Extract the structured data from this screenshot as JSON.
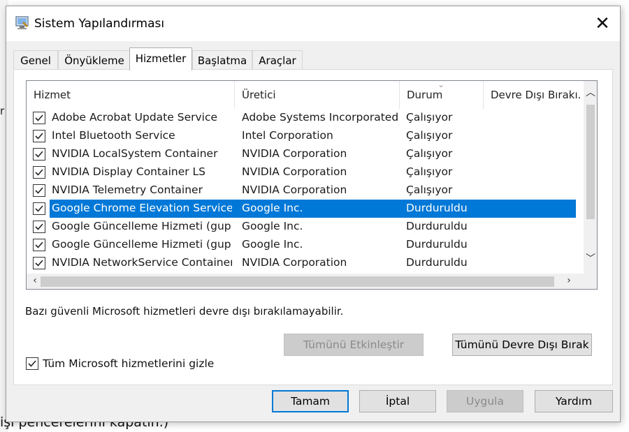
{
  "background": {
    "text": "işi pencerelerini kapatın.)"
  },
  "window": {
    "title": "Sistem Yapılandırması",
    "close_glyph": "✕"
  },
  "tabs": [
    {
      "label": "Genel",
      "active": false
    },
    {
      "label": "Önyükleme",
      "active": false
    },
    {
      "label": "Hizmetler",
      "active": true
    },
    {
      "label": "Başlatma",
      "active": false
    },
    {
      "label": "Araçlar",
      "active": false
    }
  ],
  "services": {
    "columns": [
      "Hizmet",
      "Üretici",
      "Durum",
      "Devre Dışı Bırakı."
    ],
    "rows": [
      {
        "name": "Adobe Acrobat Update Service",
        "vendor": "Adobe Systems Incorporated",
        "status": "Çalışıyor",
        "checked": true,
        "selected": false
      },
      {
        "name": "Intel Bluetooth Service",
        "vendor": "Intel Corporation",
        "status": "Çalışıyor",
        "checked": true,
        "selected": false
      },
      {
        "name": "NVIDIA LocalSystem Container",
        "vendor": "NVIDIA Corporation",
        "status": "Çalışıyor",
        "checked": true,
        "selected": false
      },
      {
        "name": "NVIDIA Display Container LS",
        "vendor": "NVIDIA Corporation",
        "status": "Çalışıyor",
        "checked": true,
        "selected": false
      },
      {
        "name": "NVIDIA Telemetry Container",
        "vendor": "NVIDIA Corporation",
        "status": "Çalışıyor",
        "checked": true,
        "selected": false
      },
      {
        "name": "Google Chrome Elevation Service",
        "vendor": "Google Inc.",
        "status": "Durduruldu",
        "checked": true,
        "selected": true
      },
      {
        "name": "Google Güncelleme Hizmeti (gup...",
        "vendor": "Google Inc.",
        "status": "Durduruldu",
        "checked": true,
        "selected": false
      },
      {
        "name": "Google Güncelleme Hizmeti (gup...",
        "vendor": "Google Inc.",
        "status": "Durduruldu",
        "checked": true,
        "selected": false
      },
      {
        "name": "NVIDIA NetworkService Container",
        "vendor": "NVIDIA Corporation",
        "status": "Durduruldu",
        "checked": true,
        "selected": false
      }
    ]
  },
  "note": "Bazı güvenli Microsoft hizmetleri devre dışı bırakılamayabilir.",
  "buttons": {
    "enable_all": "Tümünü Etkinleştir",
    "disable_all": "Tümünü Devre Dışı Bırak",
    "ok": "Tamam",
    "cancel": "İptal",
    "apply": "Uygula",
    "help": "Yardım"
  },
  "hide_ms": {
    "label": "Tüm Microsoft hizmetlerini gizle",
    "checked": true
  },
  "colors": {
    "selection": "#0078d7",
    "dialog_bg": "#f0f0f0"
  }
}
